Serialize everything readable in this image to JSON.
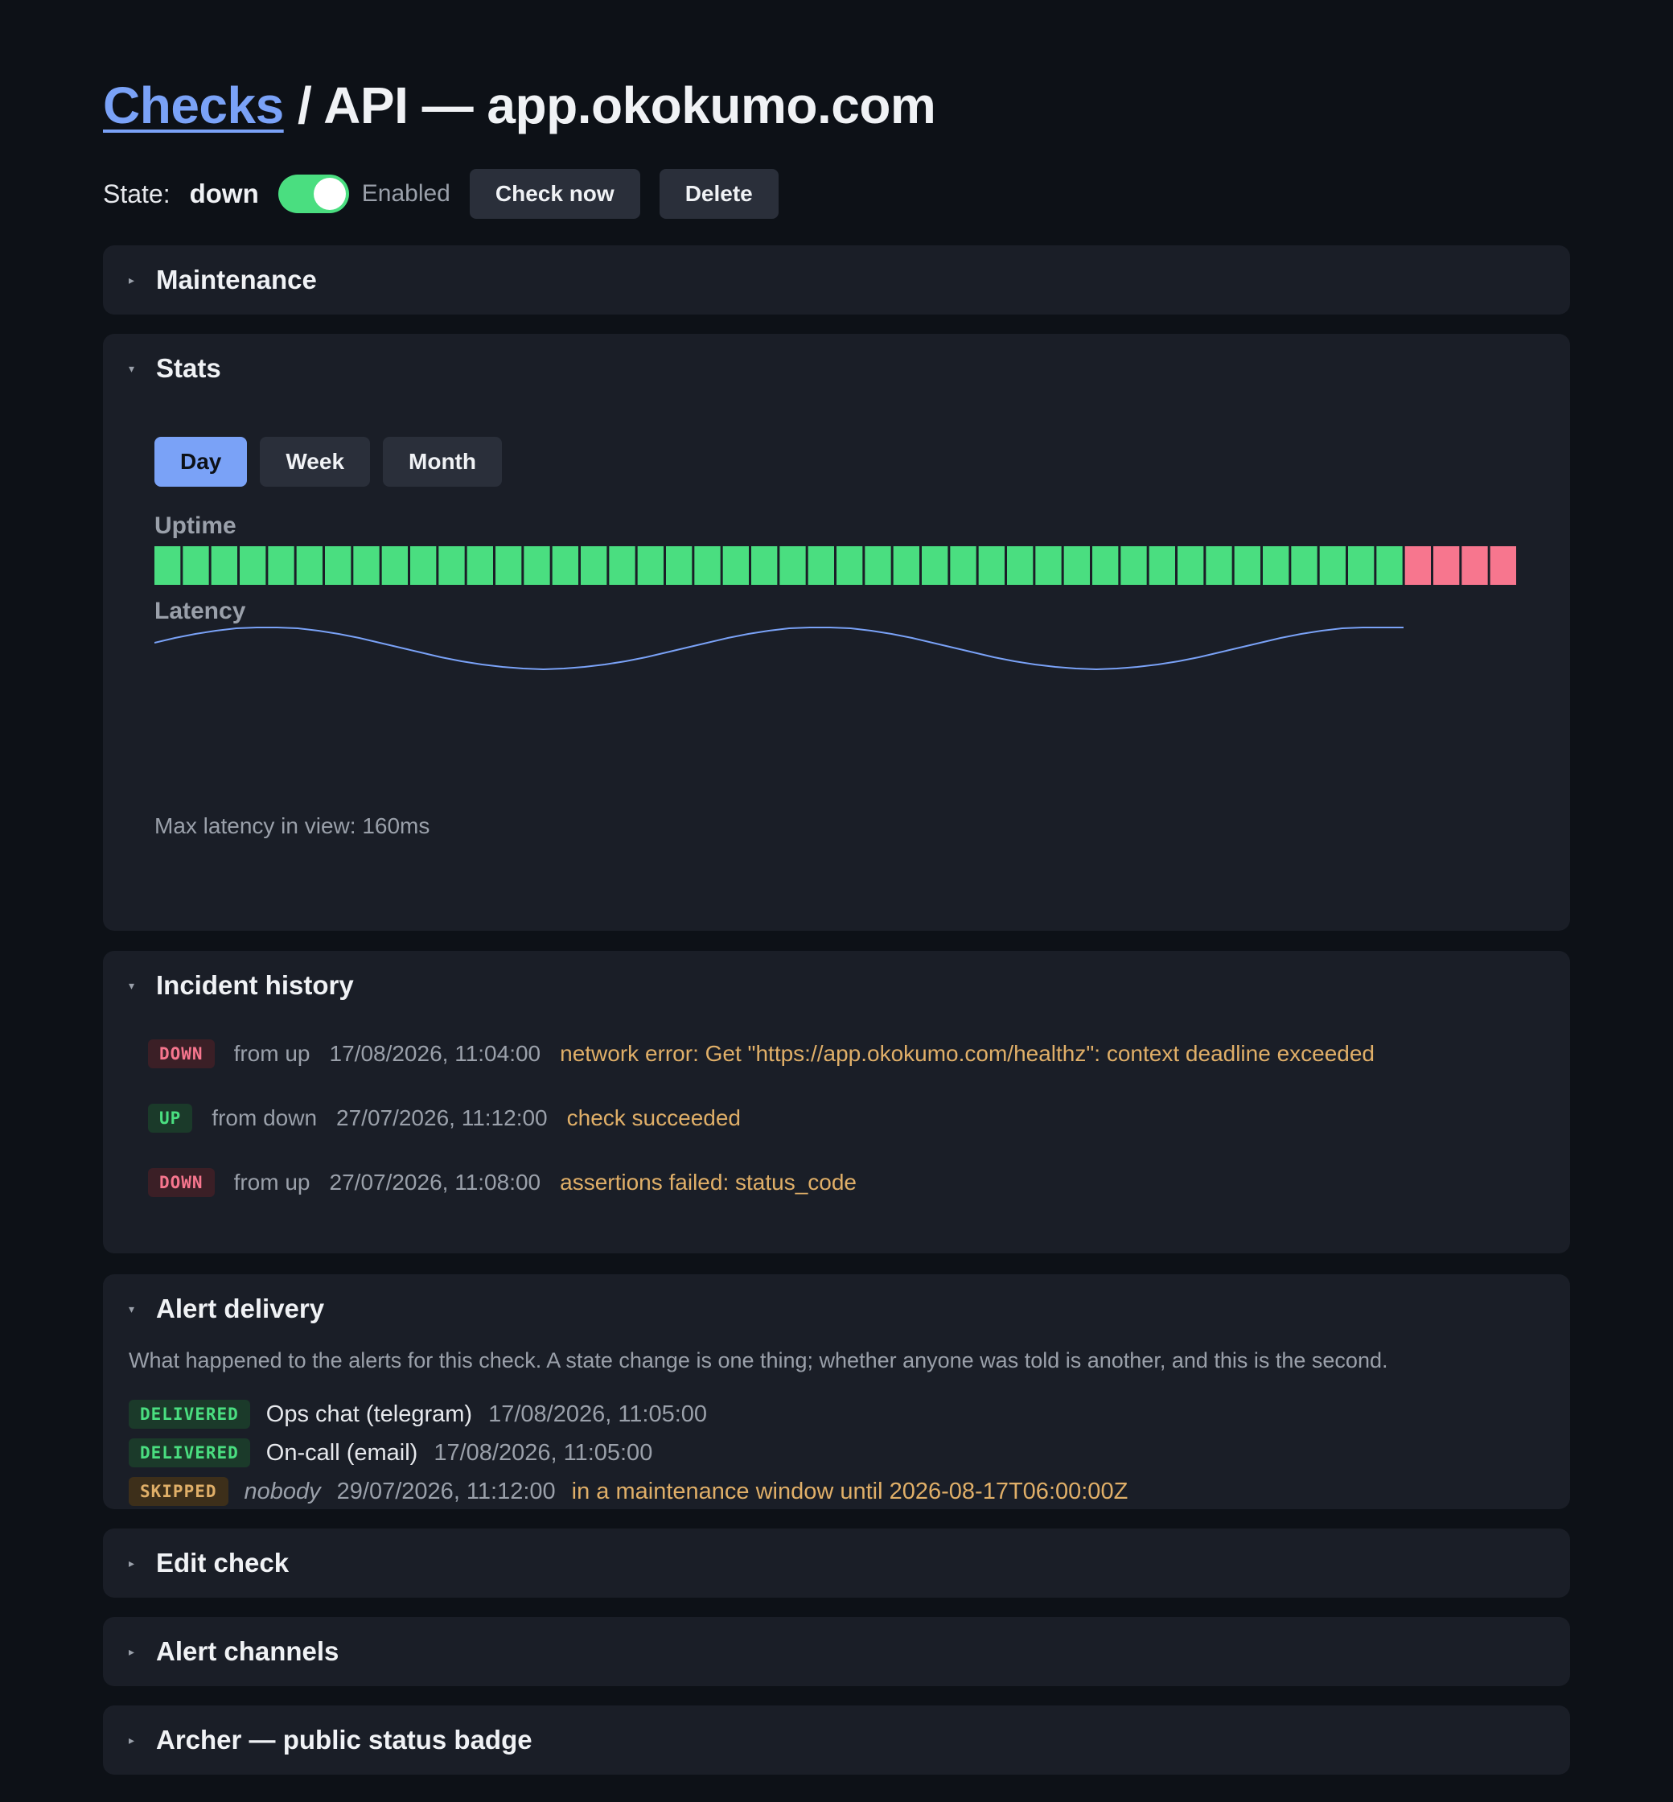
{
  "breadcrumb": {
    "root": "Checks",
    "separator": " / ",
    "current": "API — app.okokumo.com"
  },
  "state": {
    "label": "State:",
    "value": "down",
    "enabled_label": "Enabled",
    "enabled": true
  },
  "actions": {
    "check_now": "Check now",
    "delete": "Delete"
  },
  "panels": {
    "maintenance": {
      "title": "Maintenance",
      "expanded": false
    },
    "stats": {
      "title": "Stats",
      "expanded": true,
      "ranges": [
        "Day",
        "Week",
        "Month"
      ],
      "active_range": "Day",
      "uptime_label": "Uptime",
      "latency_label": "Latency",
      "max_latency_text": "Max latency in view: 160ms"
    },
    "incidents": {
      "title": "Incident history",
      "expanded": true,
      "items": [
        {
          "state": "DOWN",
          "from": "from up",
          "time": "17/08/2026, 11:04:00",
          "message": "network error: Get \"https://app.okokumo.com/healthz\": context deadline exceeded"
        },
        {
          "state": "UP",
          "from": "from down",
          "time": "27/07/2026, 11:12:00",
          "message": "check succeeded"
        },
        {
          "state": "DOWN",
          "from": "from up",
          "time": "27/07/2026, 11:08:00",
          "message": "assertions failed: status_code"
        }
      ]
    },
    "alert_delivery": {
      "title": "Alert delivery",
      "expanded": true,
      "description": "What happened to the alerts for this check. A state change is one thing; whether anyone was told is another, and this is the second.",
      "items": [
        {
          "status": "DELIVERED",
          "channel": "Ops chat (telegram)",
          "time": "17/08/2026, 11:05:00",
          "reason": ""
        },
        {
          "status": "DELIVERED",
          "channel": "On-call (email)",
          "time": "17/08/2026, 11:05:00",
          "reason": ""
        },
        {
          "status": "SKIPPED",
          "channel": "nobody",
          "time": "29/07/2026, 11:12:00",
          "reason": "in a maintenance window until 2026-08-17T06:00:00Z"
        }
      ]
    },
    "edit_check": {
      "title": "Edit check",
      "expanded": false
    },
    "alert_channels": {
      "title": "Alert channels",
      "expanded": false
    },
    "status_badge": {
      "title": "Archer — public status badge",
      "expanded": false
    }
  },
  "chart_data": [
    {
      "type": "heatmap",
      "title": "Uptime",
      "values": [
        "up",
        "up",
        "up",
        "up",
        "up",
        "up",
        "up",
        "up",
        "up",
        "up",
        "up",
        "up",
        "up",
        "up",
        "up",
        "up",
        "up",
        "up",
        "up",
        "up",
        "up",
        "up",
        "up",
        "up",
        "up",
        "up",
        "up",
        "up",
        "up",
        "up",
        "up",
        "up",
        "up",
        "up",
        "up",
        "up",
        "up",
        "up",
        "up",
        "up",
        "up",
        "up",
        "up",
        "up",
        "down",
        "down",
        "down",
        "down"
      ],
      "colors": {
        "up": "#4ade80",
        "down": "#f7768e"
      }
    },
    {
      "type": "line",
      "title": "Latency",
      "ylim": [
        0,
        160
      ],
      "series": [
        {
          "values": [
            136,
            142,
            147,
            151,
            154,
            155,
            155,
            154,
            151,
            147,
            142,
            136,
            130,
            124,
            118,
            113,
            109,
            106,
            104,
            103,
            104,
            106,
            109,
            113,
            118,
            124,
            130,
            136,
            142,
            147,
            151,
            154,
            155,
            155,
            154,
            151,
            147,
            142,
            136,
            130,
            124,
            118,
            113,
            109,
            106,
            104,
            103,
            104,
            106,
            109,
            113,
            118,
            124,
            130,
            136,
            142,
            147,
            151,
            154,
            155,
            155,
            155
          ]
        }
      ],
      "color": "#7aa2f7"
    }
  ]
}
